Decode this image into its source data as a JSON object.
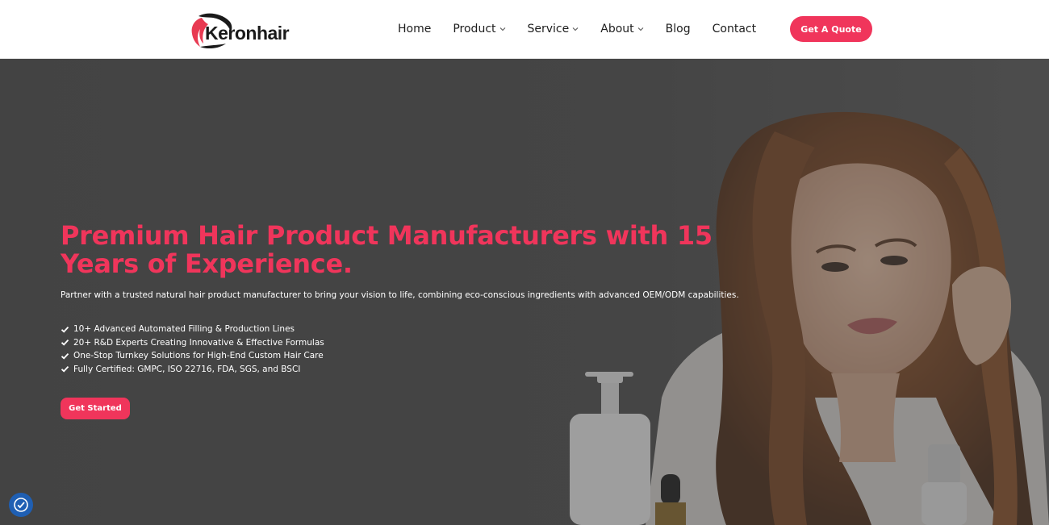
{
  "brand": {
    "name": "Keronhair",
    "accent": "#f0355b"
  },
  "nav": {
    "items": [
      {
        "label": "Home",
        "dropdown": false
      },
      {
        "label": "Product",
        "dropdown": true
      },
      {
        "label": "Service",
        "dropdown": true
      },
      {
        "label": "About",
        "dropdown": true
      },
      {
        "label": "Blog",
        "dropdown": false
      },
      {
        "label": "Contact",
        "dropdown": false
      }
    ],
    "cta_label": "Get A Quote"
  },
  "hero": {
    "title": "Premium Hair Product Manufacturers with 15 Years of Experience.",
    "subtitle": "Partner with a trusted natural hair product manufacturer to bring your vision to life, combining eco-conscious ingredients with advanced OEM/ODM capabilities.",
    "features": [
      "10+ Advanced Automated Filling & Production Lines",
      "20+ R&D Experts Creating Innovative & Effective Formulas",
      "One-Stop Turnkey Solutions for High-End Custom Hair Care",
      "Fully Certified: GMPC, ISO 22716, FDA, SGS, and BSCI"
    ],
    "cta_label": "Get Started"
  },
  "icons": {
    "feature_bullet": "check-icon",
    "accessibility": "accessibility-icon",
    "dropdown": "chevron-down-icon"
  },
  "colors": {
    "accent": "#f0355b",
    "hero_background": "#4a4a4a",
    "accessibility_button": "#1f5fb3"
  }
}
